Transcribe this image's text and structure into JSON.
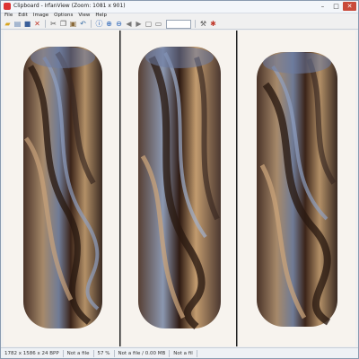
{
  "window": {
    "title": "Clipboard - IrfanView (Zoom: 1081 x 901)",
    "controls": {
      "minimize": "–",
      "maximize": "□",
      "close": "✕"
    }
  },
  "menu": [
    "File",
    "Edit",
    "Image",
    "Options",
    "View",
    "Help"
  ],
  "toolbar": {
    "icons": [
      "open-icon",
      "slideshow-icon",
      "save-icon",
      "delete-icon",
      "cut-icon",
      "copy-icon",
      "paste-icon",
      "undo-icon",
      "info-icon",
      "zoom-in-icon",
      "zoom-out-icon",
      "previous-icon",
      "next-icon",
      "fit-icon",
      "print-icon",
      "settings-icon",
      "exit-icon"
    ],
    "zoom_value": ""
  },
  "image": {
    "description_colors": {
      "background": "#f7f3ee",
      "bead_dark": "#3c2418",
      "bead_tan": "#b08a5e",
      "bead_blue": "#7f8fae"
    },
    "panels": 3
  },
  "status": {
    "dims": "1782 x 1586 x 24 BPP",
    "file1": "Not a file",
    "zoom": "57 %",
    "file2": "Not a file / 0.00 MB",
    "file3": "Not a fil"
  }
}
